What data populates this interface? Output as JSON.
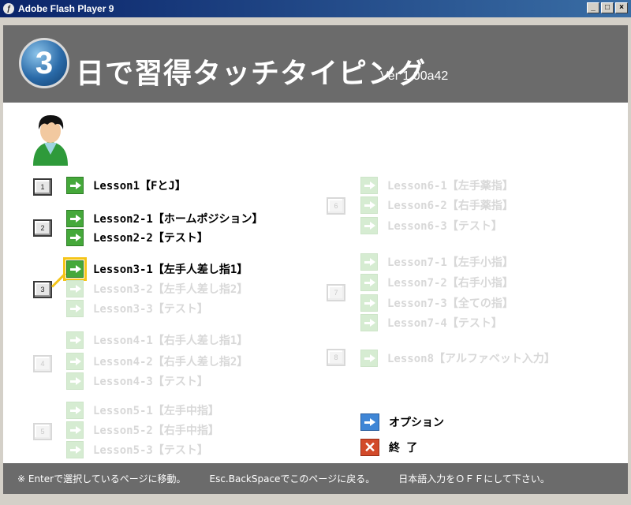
{
  "window": {
    "title": "Adobe Flash Player 9",
    "buttons": [
      "_",
      "□",
      "×"
    ]
  },
  "header": {
    "logo_number": "3",
    "title": "日で習得タッチタイピング",
    "version": "Ver 1.00a42"
  },
  "groups": [
    {
      "key": "1",
      "active": true
    },
    {
      "key": "2",
      "active": true
    },
    {
      "key": "3",
      "active": true
    },
    {
      "key": "4",
      "active": false
    },
    {
      "key": "5",
      "active": false
    },
    {
      "key": "6",
      "active": false
    },
    {
      "key": "7",
      "active": false
    },
    {
      "key": "8",
      "active": false
    }
  ],
  "lessons": {
    "l1": "Lesson1【FとJ】",
    "l2_1": "Lesson2-1【ホームポジション】",
    "l2_2": "Lesson2-2【テスト】",
    "l3_1": "Lesson3-1【左手人差し指1】",
    "l3_2": "Lesson3-2【左手人差し指2】",
    "l3_3": "Lesson3-3【テスト】",
    "l4_1": "Lesson4-1【右手人差し指1】",
    "l4_2": "Lesson4-2【右手人差し指2】",
    "l4_3": "Lesson4-3【テスト】",
    "l5_1": "Lesson5-1【左手中指】",
    "l5_2": "Lesson5-2【右手中指】",
    "l5_3": "Lesson5-3【テスト】",
    "l6_1": "Lesson6-1【左手薬指】",
    "l6_2": "Lesson6-2【右手薬指】",
    "l6_3": "Lesson6-3【テスト】",
    "l7_1": "Lesson7-1【左手小指】",
    "l7_2": "Lesson7-2【右手小指】",
    "l7_3": "Lesson7-3【全ての指】",
    "l7_4": "Lesson7-4【テスト】",
    "l8": "Lesson8【アルファベット入力】"
  },
  "menu": {
    "option_label": "オプション",
    "exit_label": "終 了"
  },
  "footer": {
    "hint1": "※ Enterで選択しているページに移動。",
    "hint2": "Esc.BackSpaceでこのページに戻る。",
    "hint3": "日本語入力をＯＦＦにして下さい。"
  },
  "colors": {
    "header_bg": "#6b6b6b",
    "arrow_active": "#45a83a",
    "arrow_dim": "#d6ecd2",
    "selection": "#f5c518",
    "option_blue": "#3f86d6",
    "exit_red": "#d24a2a"
  },
  "icons": {
    "lesson": "right-arrow-icon",
    "option": "right-arrow-icon",
    "exit": "close-icon",
    "avatar": "user-avatar-icon"
  }
}
